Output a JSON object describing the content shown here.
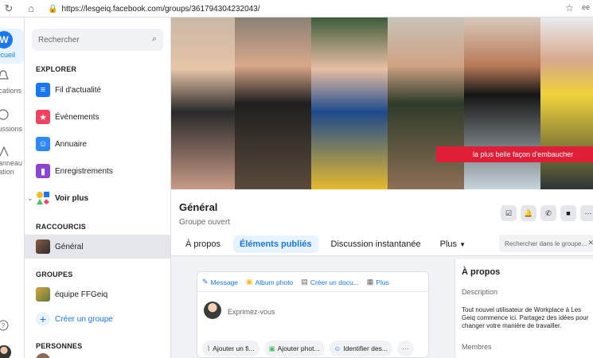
{
  "browser": {
    "url": "https://lesgeiq.facebook.com/groups/361794304232043/",
    "extension_label": "ee"
  },
  "rail": {
    "home_label": "Accueil",
    "notif_label": "Notifications",
    "discussions_label": "Discussions",
    "admin_label_1": "Panneau",
    "admin_label_2": "d'administration"
  },
  "sidebar": {
    "search_placeholder": "Rechercher",
    "explorer_heading": "EXPLORER",
    "explorer_items": [
      {
        "label": "Fil d'actualité"
      },
      {
        "label": "Évènements"
      },
      {
        "label": "Annuaire"
      },
      {
        "label": "Enregistrements"
      },
      {
        "label": "Voir plus"
      }
    ],
    "shortcuts_heading": "RACCOURCIS",
    "shortcut_general": "Général",
    "groups_heading": "GROUPES",
    "group_item": "équipe FFGeiq",
    "create_group": "Créer un groupe",
    "people_heading": "PERSONNES"
  },
  "cover": {
    "banner_text": "la plus belle façon d'embaucher",
    "colors": {
      "banner": "#e01e37"
    }
  },
  "group": {
    "title": "Général",
    "subtitle": "Groupe ouvert",
    "tabs": [
      {
        "label": "À propos"
      },
      {
        "label": "Éléments publiés"
      },
      {
        "label": "Discussion instantanée"
      },
      {
        "label": "Plus"
      }
    ],
    "search_placeholder": "Rechercher dans le groupe..."
  },
  "composer": {
    "tabs": [
      {
        "label": "Message"
      },
      {
        "label": "Album photo"
      },
      {
        "label": "Créer un docu..."
      },
      {
        "label": "Plus"
      }
    ],
    "placeholder": "Exprimez-vous",
    "buttons": [
      {
        "label": "Ajouter un fi..."
      },
      {
        "label": "Ajouter phot..."
      },
      {
        "label": "Identifier des..."
      }
    ]
  },
  "about": {
    "heading": "À propos",
    "description_label": "Description",
    "description_text": "Tout nouvel utilisateur de Workplace à Les Geiq commence ici. Partagez des idées pour changer votre manière de travailler.",
    "members_label": "Membres"
  }
}
